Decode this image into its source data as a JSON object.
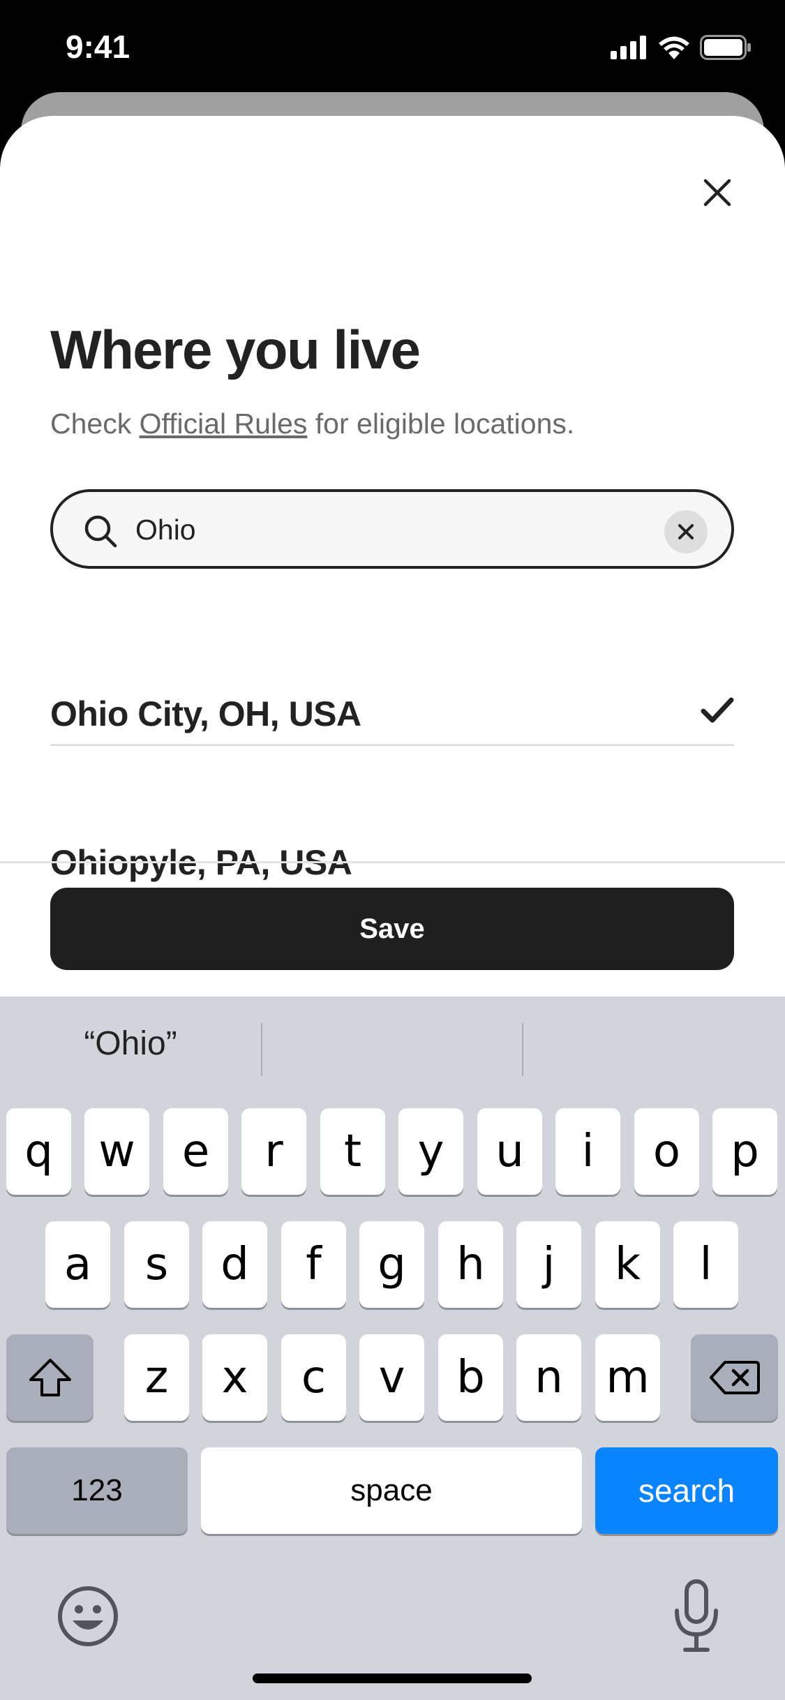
{
  "status_bar": {
    "time": "9:41"
  },
  "sheet": {
    "title": "Where you live",
    "subtitle_prefix": "Check ",
    "subtitle_link": "Official Rules",
    "subtitle_suffix": " for eligible locations.",
    "search": {
      "value": "Ohio",
      "placeholder": ""
    },
    "results": [
      {
        "label": "Ohio City, OH, USA",
        "selected": true
      },
      {
        "label": "Ohiopyle, PA, USA",
        "selected": false
      }
    ],
    "save_label": "Save"
  },
  "keyboard": {
    "suggestions": [
      "“Ohio”",
      "",
      ""
    ],
    "row1": [
      "q",
      "w",
      "e",
      "r",
      "t",
      "y",
      "u",
      "i",
      "o",
      "p"
    ],
    "row2": [
      "a",
      "s",
      "d",
      "f",
      "g",
      "h",
      "j",
      "k",
      "l"
    ],
    "row3": [
      "z",
      "x",
      "c",
      "v",
      "b",
      "n",
      "m"
    ],
    "numbers_label": "123",
    "space_label": "space",
    "search_label": "search"
  },
  "colors": {
    "accent_blue": "#0a84ff",
    "button_dark": "#1f1f1f",
    "keyboard_bg": "#d1d4db"
  }
}
